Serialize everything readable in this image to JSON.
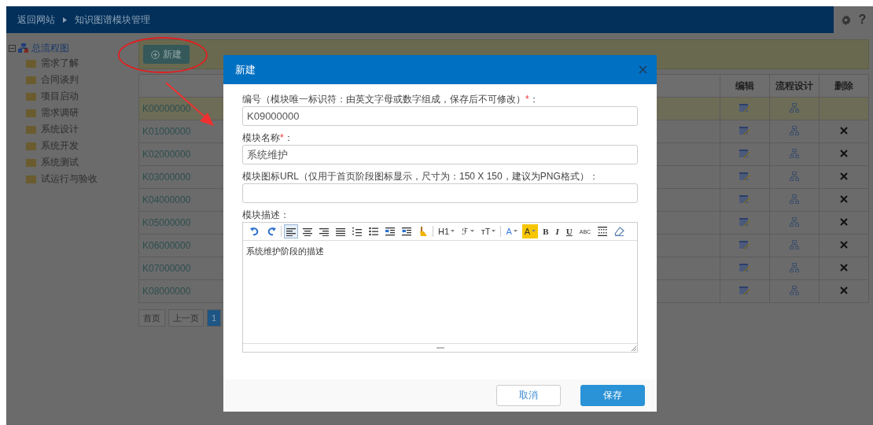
{
  "header": {
    "breadcrumb": [
      "返回网站",
      "知识图谱模块管理"
    ],
    "help": "?"
  },
  "sidebar": {
    "root": {
      "label": "总流程图",
      "expanded": true,
      "children": [
        {
          "label": "需求了解"
        },
        {
          "label": "合同谈判"
        },
        {
          "label": "项目启动"
        },
        {
          "label": "需求调研"
        },
        {
          "label": "系统设计"
        },
        {
          "label": "系统开发"
        },
        {
          "label": "系统测试"
        },
        {
          "label": "试运行与验收"
        }
      ]
    }
  },
  "toolbar": {
    "new_button": "新建"
  },
  "table": {
    "columns": [
      "编辑",
      "流程设计",
      "删除"
    ],
    "rows": [
      {
        "code": "K00000000",
        "selected": true,
        "deletable": false
      },
      {
        "code": "K01000000",
        "selected": false,
        "deletable": true
      },
      {
        "code": "K02000000",
        "selected": false,
        "deletable": true
      },
      {
        "code": "K03000000",
        "selected": false,
        "deletable": true
      },
      {
        "code": "K04000000",
        "selected": false,
        "deletable": true
      },
      {
        "code": "K05000000",
        "selected": false,
        "deletable": true
      },
      {
        "code": "K06000000",
        "selected": false,
        "deletable": true
      },
      {
        "code": "K07000000",
        "selected": false,
        "deletable": true
      },
      {
        "code": "K08000000",
        "selected": false,
        "deletable": true
      }
    ]
  },
  "pagination": [
    {
      "label": "首页",
      "selected": false
    },
    {
      "label": "上一页",
      "selected": false
    },
    {
      "label": "1",
      "selected": true
    }
  ],
  "dialog": {
    "title": "新建",
    "fields": [
      {
        "label": "编号（模块唯一标识符：由英文字母或数字组成，保存后不可修改）",
        "required_mark": "*",
        "colon": "：",
        "value": "K09000000"
      },
      {
        "label": "模块名称",
        "required_mark": "*",
        "colon": "：",
        "value": "系统维护"
      },
      {
        "label": "模块图标URL（仅用于首页阶段图标显示，尺寸为：150 X 150，建议为PNG格式）",
        "colon": "："
      }
    ],
    "editor": {
      "label": "模块描述：",
      "content": "系统维护阶段的描述",
      "toolbar": [
        {
          "kind": "undo",
          "selected": false
        },
        {
          "kind": "redo",
          "selected": false
        },
        {
          "kind": "separator"
        },
        {
          "kind": "align-left",
          "selected": true
        },
        {
          "kind": "align-center",
          "selected": false
        },
        {
          "kind": "align-right",
          "selected": false
        },
        {
          "kind": "justify",
          "selected": false
        },
        {
          "kind": "ordered-list",
          "selected": false
        },
        {
          "kind": "bullet-list",
          "selected": false
        },
        {
          "kind": "indent",
          "selected": false
        },
        {
          "kind": "outdent",
          "selected": false
        },
        {
          "kind": "format-brush",
          "selected": false
        },
        {
          "kind": "separator"
        },
        {
          "kind": "heading",
          "text": "H1",
          "dropdown": true,
          "selected": false
        },
        {
          "kind": "font-family",
          "text": "ℱ",
          "dropdown": true,
          "selected": false
        },
        {
          "kind": "font-size",
          "text": "тT",
          "dropdown": true,
          "selected": false
        },
        {
          "kind": "separator"
        },
        {
          "kind": "font-color",
          "text": "A",
          "dropdown": true,
          "selected": false
        },
        {
          "kind": "highlight",
          "text": "A",
          "dropdown": true,
          "selected": false
        },
        {
          "kind": "bold",
          "text": "B",
          "selected": false
        },
        {
          "kind": "italic",
          "text": "I",
          "selected": false
        },
        {
          "kind": "underline",
          "text": "U",
          "selected": false
        },
        {
          "kind": "strike",
          "text": "ABC",
          "selected": false
        },
        {
          "kind": "table",
          "selected": false
        },
        {
          "kind": "eraser",
          "selected": false
        }
      ]
    },
    "buttons": [
      {
        "label": "取消",
        "kind": "secondary"
      },
      {
        "label": "保存",
        "kind": "primary"
      }
    ]
  }
}
